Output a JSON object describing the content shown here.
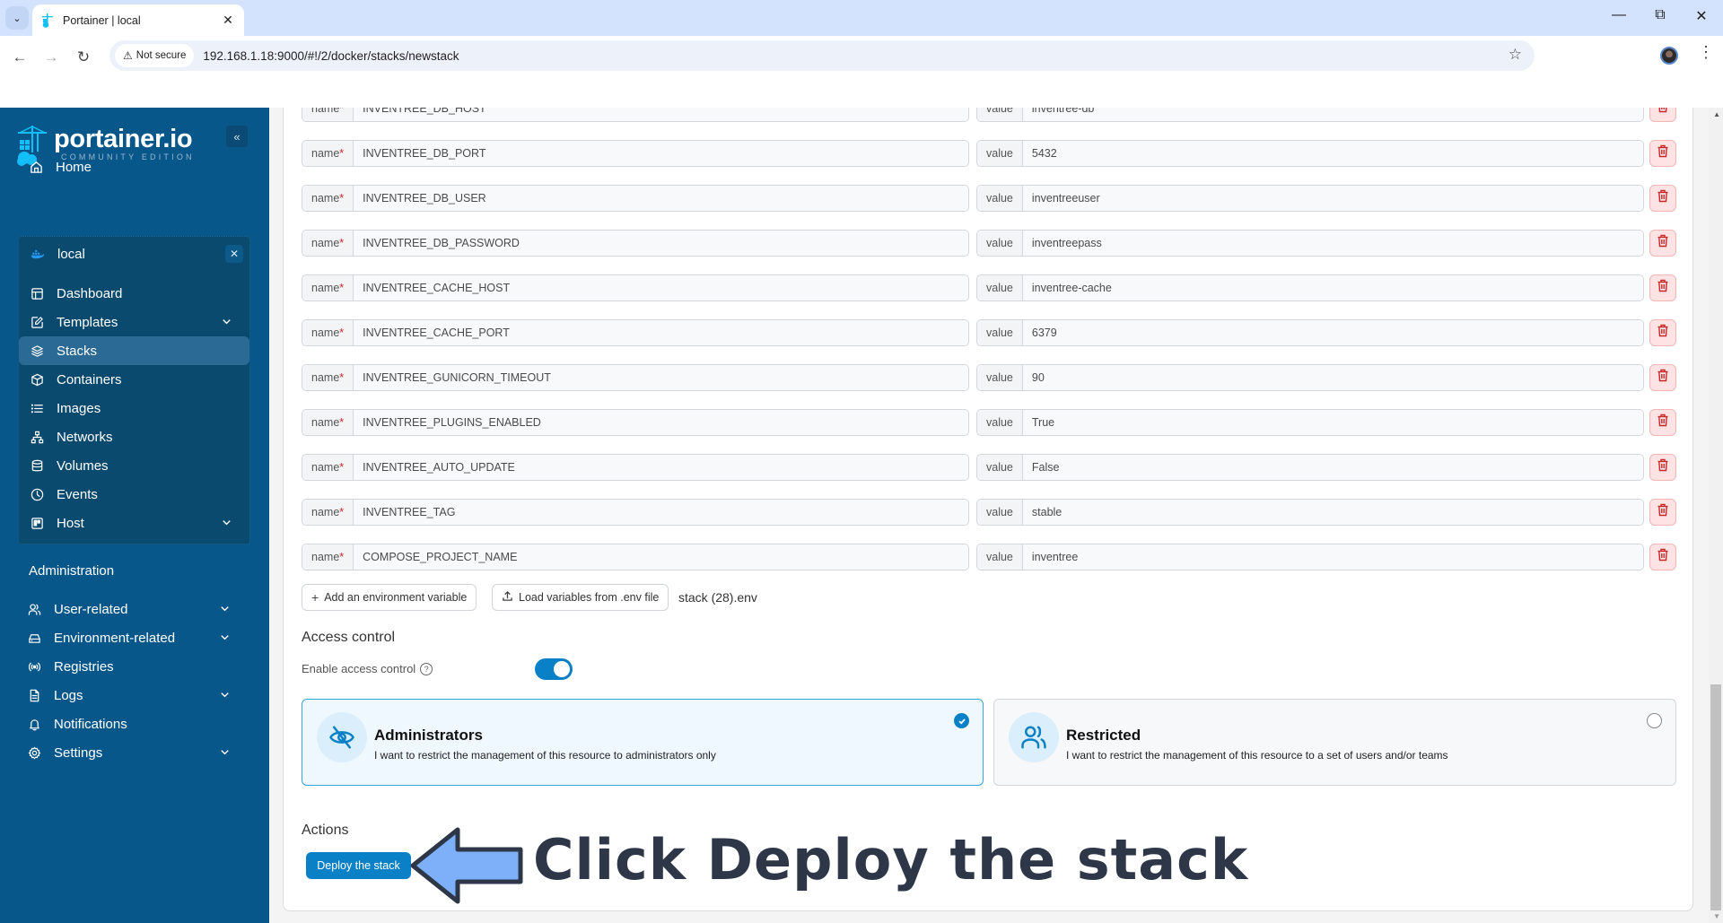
{
  "browser": {
    "tab_title": "Portainer | local",
    "not_secure_label": "Not secure",
    "url": "192.168.1.18:9000/#!/2/docker/stacks/newstack"
  },
  "sidebar": {
    "logo_text": "portainer.io",
    "logo_subtext": "COMMUNITY EDITION",
    "home_label": "Home",
    "environment": {
      "name": "local",
      "items": [
        {
          "label": "Dashboard",
          "icon": "dashboard-icon",
          "expandable": false
        },
        {
          "label": "Templates",
          "icon": "edit-icon",
          "expandable": true
        },
        {
          "label": "Stacks",
          "icon": "layers-icon",
          "expandable": false,
          "active": true
        },
        {
          "label": "Containers",
          "icon": "box-icon",
          "expandable": false
        },
        {
          "label": "Images",
          "icon": "list-icon",
          "expandable": false
        },
        {
          "label": "Networks",
          "icon": "network-icon",
          "expandable": false
        },
        {
          "label": "Volumes",
          "icon": "database-icon",
          "expandable": false
        },
        {
          "label": "Events",
          "icon": "clock-icon",
          "expandable": false
        },
        {
          "label": "Host",
          "icon": "host-icon",
          "expandable": true
        }
      ]
    },
    "admin_header": "Administration",
    "admin_items": [
      {
        "label": "User-related",
        "icon": "users-icon",
        "expandable": true
      },
      {
        "label": "Environment-related",
        "icon": "hard-drive-icon",
        "expandable": true
      },
      {
        "label": "Registries",
        "icon": "radio-icon",
        "expandable": false
      },
      {
        "label": "Logs",
        "icon": "file-text-icon",
        "expandable": true
      },
      {
        "label": "Notifications",
        "icon": "bell-icon",
        "expandable": false
      },
      {
        "label": "Settings",
        "icon": "gear-icon",
        "expandable": true
      }
    ]
  },
  "env_vars": {
    "name_label": "name",
    "required_mark": "*",
    "value_label": "value",
    "rows": [
      {
        "name": "INVENTREE_DB_HOST",
        "value": "inventree-db"
      },
      {
        "name": "INVENTREE_DB_PORT",
        "value": "5432"
      },
      {
        "name": "INVENTREE_DB_USER",
        "value": "inventreeuser"
      },
      {
        "name": "INVENTREE_DB_PASSWORD",
        "value": "inventreepass"
      },
      {
        "name": "INVENTREE_CACHE_HOST",
        "value": "inventree-cache"
      },
      {
        "name": "INVENTREE_CACHE_PORT",
        "value": "6379"
      },
      {
        "name": "INVENTREE_GUNICORN_TIMEOUT",
        "value": "90"
      },
      {
        "name": "INVENTREE_PLUGINS_ENABLED",
        "value": "True"
      },
      {
        "name": "INVENTREE_AUTO_UPDATE",
        "value": "False"
      },
      {
        "name": "INVENTREE_TAG",
        "value": "stable"
      },
      {
        "name": "COMPOSE_PROJECT_NAME",
        "value": "inventree"
      }
    ],
    "add_button": "Add an environment variable",
    "load_button": "Load variables from .env file",
    "loaded_file": "stack (28).env"
  },
  "access_control": {
    "title": "Access control",
    "enable_label": "Enable access control",
    "enabled": true,
    "options": [
      {
        "title": "Administrators",
        "description": "I want to restrict the management of this resource to administrators only",
        "selected": true
      },
      {
        "title": "Restricted",
        "description": "I want to restrict the management of this resource to a set of users and/or teams",
        "selected": false
      }
    ]
  },
  "actions": {
    "title": "Actions",
    "deploy_button": "Deploy the stack"
  },
  "annotation": {
    "text": "Click Deploy the stack"
  },
  "colors": {
    "sidebar_bg": "#07578b",
    "accent": "#0a81c6",
    "danger": "#c62828"
  }
}
